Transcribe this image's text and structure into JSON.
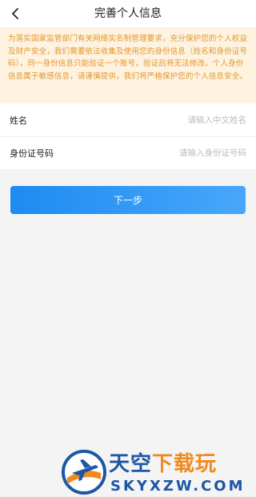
{
  "nav": {
    "title": "完善个人信息",
    "back_icon": "chevron-left-icon"
  },
  "notice": {
    "text": "为落实国家监管部门有关网络实名制管理要求，充分保护您的个人权益及财产安全，我们需要依法收集及使用您的身份信息（姓名和身份证号码），同一身份信息只能验证一个账号，验证后将无法修改。个人身份信息属于敏感信息，请谨慎提供，我们将严格保护您的个人信息安全。",
    "color": "#e3962f",
    "background": "#fdf3e0"
  },
  "form": {
    "name": {
      "label": "姓名",
      "placeholder": "请输入中文姓名",
      "value": ""
    },
    "id_number": {
      "label": "身份证号码",
      "placeholder": "请输入身份证号码",
      "value": ""
    }
  },
  "next_button": {
    "label": "下一步",
    "color": "#2f97f6"
  },
  "watermark": {
    "brand_part1": "天空",
    "brand_part2": "下载玩",
    "domain": "SKYXZW.COM",
    "icon": "airplane-logo-icon"
  }
}
